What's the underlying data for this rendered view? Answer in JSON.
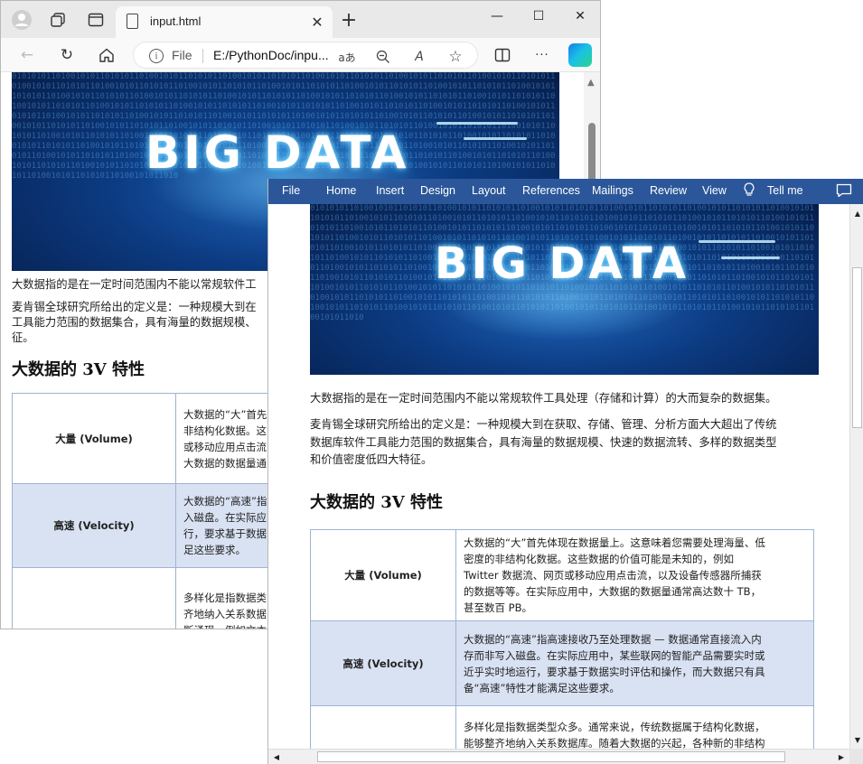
{
  "browser": {
    "tab_title": "input.html",
    "address_scheme": "File",
    "address_url": "E:/PythonDoc/inpu...",
    "read_aloud_glyph": "aあ",
    "text_size_glyph": "A",
    "close_glyph": "✕",
    "minimize_glyph": "—",
    "maximize_glyph": "☐",
    "more_glyph": "···"
  },
  "banner_text": "BIG DATA",
  "binary_text": "0101010110100101011010101101001010110101011010010101101010110100101011010101101001010110101011010010101101010110100101011010101101001010110101011010010101101010110100101011010101101001010110101011010010101101010110100101011010101101001010110101011010010101101010110100101011010101101001010110101011010010101101010110100101011010101101001010110101011010010101101010110100101011010101101001010110101011010010101101010110100101011010101101001010110101011010010101101010110100101011010101101001010110101011010010101101010110100101011010101101001010110101011010010101101010110100101011010101101001010110101011010010101101010110100101011010101101001010110101011010010101101010110100101011010101101001010110101011010010101101010110100101011010101101001010110101011010010101101010110100101011010101101001010110101011010010101101010110100101011010101101001010110101011010010101101010110100101011010101101001010110101011010010101101010110100101011010101101001010110101011010010101101010110100101011010101101001010110101011010010101101010110100101011010101101001010110101011010010101101010110100101011010101101001010110101011010010101101010110100101011010",
  "browser_page": {
    "para1": "大数据指的是在一定时间范围内不能以常规软件工",
    "para2_line1": "麦肯锡全球研究所给出的定义是：一种规模大到在",
    "para2_line2": "工具能力范围的数据集合，具有海量的数据规模、",
    "para2_line3": "征。",
    "heading": "大数据的 3V 特性",
    "rows": [
      {
        "key": "大量 (Volume)",
        "lines": [
          "大数据的“大”首先",
          "非结构化数据。这",
          "或移动应用点击流",
          "大数据的数据量通"
        ]
      },
      {
        "key": "高速 (Velocity)",
        "lines": [
          "大数据的“高速”指",
          "入磁盘。在实际应",
          "行，要求基于数据",
          "足这些要求。"
        ]
      },
      {
        "key": "多样化 (Variety)",
        "lines": [
          "多样化是指数据类",
          "齐地纳入关系数据",
          "断涌现，例如文本"
        ]
      }
    ]
  },
  "word": {
    "menu": [
      "File",
      "Home",
      "Insert",
      "Design",
      "Layout",
      "References",
      "Mailings",
      "Review",
      "View",
      "Tell me"
    ],
    "para1": "大数据指的是在一定时间范围内不能以常规软件工具处理（存储和计算）的大而复杂的数据集。",
    "para2_lines": [
      "麦肯锡全球研究所给出的定义是：一种规模大到在获取、存储、管理、分析方面大大超出了传统",
      "数据库软件工具能力范围的数据集合，具有海量的数据规模、快速的数据流转、多样的数据类型",
      "和价值密度低四大特征。"
    ],
    "heading": "大数据的 3V 特性",
    "rows": [
      {
        "key": "大量 (Volume)",
        "lines": [
          "大数据的“大”首先体现在数据量上。这意味着您需要处理海量、低",
          "密度的非结构化数据。这些数据的价值可能是未知的，例如",
          "Twitter 数据流、网页或移动应用点击流，以及设备传感器所捕获",
          "的数据等等。在实际应用中，大数据的数据量通常高达数十 TB，",
          "甚至数百 PB。"
        ]
      },
      {
        "key": "高速 (Velocity)",
        "lines": [
          "大数据的“高速”指高速接收乃至处理数据 — 数据通常直接流入内",
          "存而非写入磁盘。在实际应用中，某些联网的智能产品需要实时或",
          "近乎实时地运行，要求基于数据实时评估和操作，而大数据只有具",
          "备“高速”特性才能满足这些要求。"
        ]
      },
      {
        "key": "",
        "lines": [
          "多样化是指数据类型众多。通常来说，传统数据属于结构化数据，",
          "能够整齐地纳入关系数据库。随着大数据的兴起，各种新的非结构"
        ]
      }
    ]
  }
}
